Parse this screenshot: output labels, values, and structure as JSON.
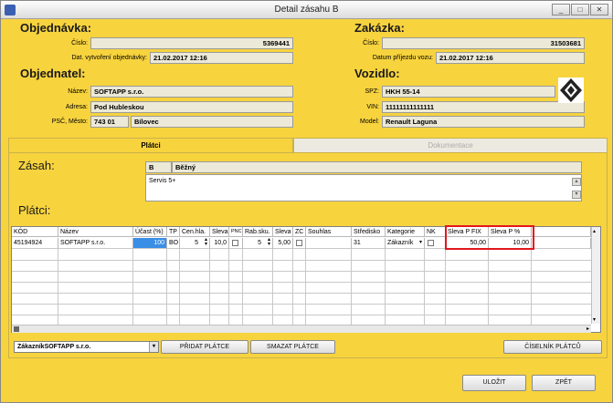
{
  "window": {
    "title": "Detail zásahu B",
    "controls": [
      "_",
      "□",
      "✕"
    ]
  },
  "order": {
    "heading": "Objednávka:",
    "number_label": "Číslo:",
    "number": "5369441",
    "created_label": "Dat. vytvoření objednávky:",
    "created": "21.02.2017 12:16"
  },
  "job": {
    "heading": "Zakázka:",
    "number_label": "Číslo:",
    "number": "31503681",
    "arrival_label": "Datum příjezdu vozu:",
    "arrival": "21.02.2017 12:16"
  },
  "customer": {
    "heading": "Objednatel:",
    "name_label": "Název:",
    "name": "SOFTAPP s.r.o.",
    "address_label": "Adresa:",
    "address": "Pod Hubleskou",
    "zipcity_label": "PSČ, Město:",
    "zip": "743 01",
    "city": "Bílovec"
  },
  "vehicle": {
    "heading": "Vozidlo:",
    "spz_label": "SPZ:",
    "spz": "HKH 55-14",
    "vin_label": "VIN:",
    "vin": "11111111111111",
    "model_label": "Model:",
    "model": "Renault Laguna",
    "logo": "renault-logo"
  },
  "tabs": [
    {
      "label": "Plátci",
      "active": true
    },
    {
      "label": "Dokumentace",
      "active": false
    }
  ],
  "intervention": {
    "heading": "Zásah:",
    "code": "B",
    "type": "Běžný",
    "description": "Servis 5+"
  },
  "payers": {
    "heading": "Plátci:",
    "columns": [
      "KÓD",
      "Název",
      "Účast (%)",
      "TP",
      "Cen.hla.",
      "Sleva",
      "PNC",
      "Rab.sku.",
      "Sleva",
      "ZC",
      "Souhlas",
      "Středisko",
      "Kategorie",
      "NK",
      "Sleva P FIX",
      "Sleva P %"
    ],
    "rows": [
      {
        "kod": "45194924",
        "nazev": "SOFTAPP s.r.o.",
        "ucast": "100",
        "tp": "BO",
        "cenhla": "5",
        "sleva1": "10,0",
        "rabsku": "5",
        "sleva2": "5,00",
        "stredisko": "31",
        "kategorie": "Zákazník",
        "fix": "50,00",
        "pct": "10,00"
      }
    ]
  },
  "footer": {
    "payer_select": "ZákazníkSOFTAPP s.r.o.",
    "add_payer": "PŘIDAT PLÁTCE",
    "delete_payer": "SMAZAT PLÁTCE",
    "payers_catalog": "ČÍSELNÍK PLÁTCŮ",
    "save": "ULOŽIT",
    "back": "ZPĚT"
  },
  "colors": {
    "window_bg": "#f7d33e",
    "highlight": "#e0181e",
    "selected_cell": "#3a8ee6"
  }
}
